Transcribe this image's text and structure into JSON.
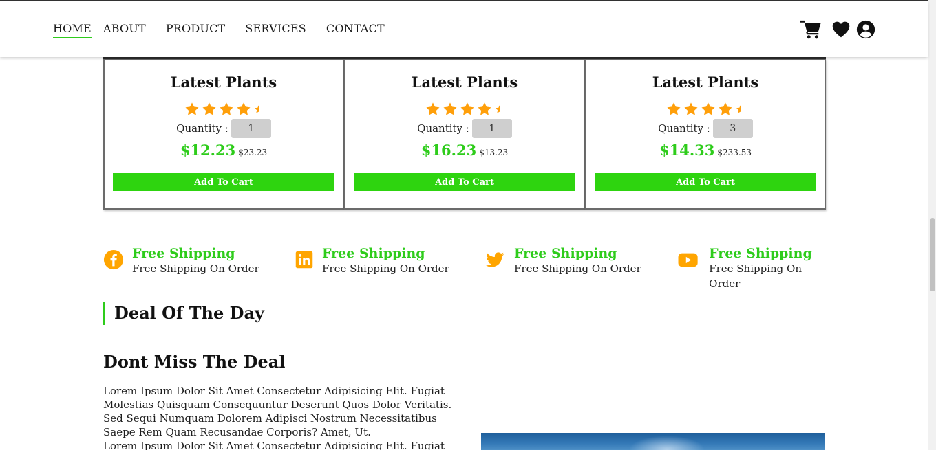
{
  "nav": {
    "items": [
      "HOME",
      "ABOUT",
      "PRODUCT",
      "SERVICES",
      "CONTACT"
    ],
    "active": "HOME"
  },
  "header_icons": [
    "cart-icon",
    "heart-icon",
    "user-circle-icon"
  ],
  "products": [
    {
      "title": "Latest Plants",
      "rating": 4.5,
      "quantity_label": "Quantity :",
      "quantity": "1",
      "price": "$12.23",
      "old_price": "$23.23",
      "button": "Add To Cart"
    },
    {
      "title": "Latest Plants",
      "rating": 4.5,
      "quantity_label": "Quantity :",
      "quantity": "1",
      "price": "$16.23",
      "old_price": "$13.23",
      "button": "Add To Cart"
    },
    {
      "title": "Latest Plants",
      "rating": 4.5,
      "quantity_label": "Quantity :",
      "quantity": "3",
      "price": "$14.33",
      "old_price": "$233.53",
      "button": "Add To Cart"
    }
  ],
  "features": [
    {
      "icon": "facebook-icon",
      "title": "Free Shipping",
      "subtitle": "Free Shipping On Order"
    },
    {
      "icon": "linkedin-icon",
      "title": "Free Shipping",
      "subtitle": "Free Shipping On Order"
    },
    {
      "icon": "twitter-icon",
      "title": "Free Shipping",
      "subtitle": "Free Shipping On Order"
    },
    {
      "icon": "youtube-icon",
      "title": "Free Shipping",
      "subtitle": "Free Shipping On Order"
    }
  ],
  "deal": {
    "section_heading": "Deal Of The Day",
    "title": "Dont Miss The Deal",
    "paragraph_1": "Lorem Ipsum Dolor Sit Amet Consectetur Adipisicing Elit. Fugiat Molestias Quisquam Consequuntur Deserunt Quos Dolor Veritatis. Sed Sequi Numquam Dolorem Adipisci Nostrum Necessitatibus Saepe Rem Quam Recusandae Corporis? Amet, Ut.",
    "paragraph_2": "Lorem Ipsum Dolor Sit Amet Consectetur Adipisicing Elit. Fugiat"
  },
  "colors": {
    "accent_green": "#2ecc1b",
    "button_green": "#2ed40f",
    "star_orange": "#ff9f0a",
    "icon_orange": "#ffa500"
  }
}
